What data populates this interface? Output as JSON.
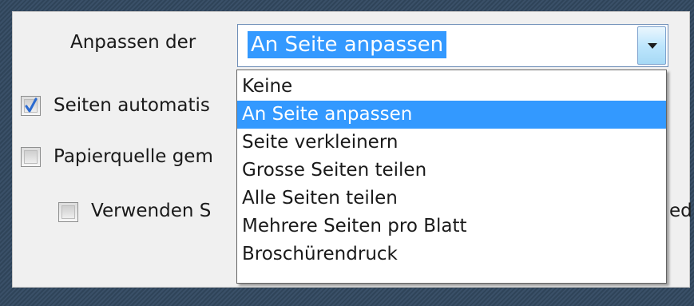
{
  "dialog": {
    "fit_label": "Anpassen der",
    "auto_rotate_label": "Seiten automatis",
    "paper_source_label": "Papierquelle gem",
    "use_label": "Verwenden S",
    "cut_off_text": "ed"
  },
  "checkboxes": {
    "auto_rotate_checked": true,
    "paper_source_checked": false,
    "use_checked": false
  },
  "combo": {
    "value": "An Seite anpassen"
  },
  "dropdown": {
    "items": [
      "Keine",
      "An Seite anpassen",
      "Seite verkleinern",
      "Grosse Seiten teilen",
      "Alle Seiten teilen",
      "Mehrere Seiten pro Blatt",
      "Broschürendruck"
    ],
    "selected_index": 1
  },
  "colors": {
    "selection": "#3399ff",
    "panel": "#f0f0f0",
    "checkmark": "#2a6ad0"
  }
}
